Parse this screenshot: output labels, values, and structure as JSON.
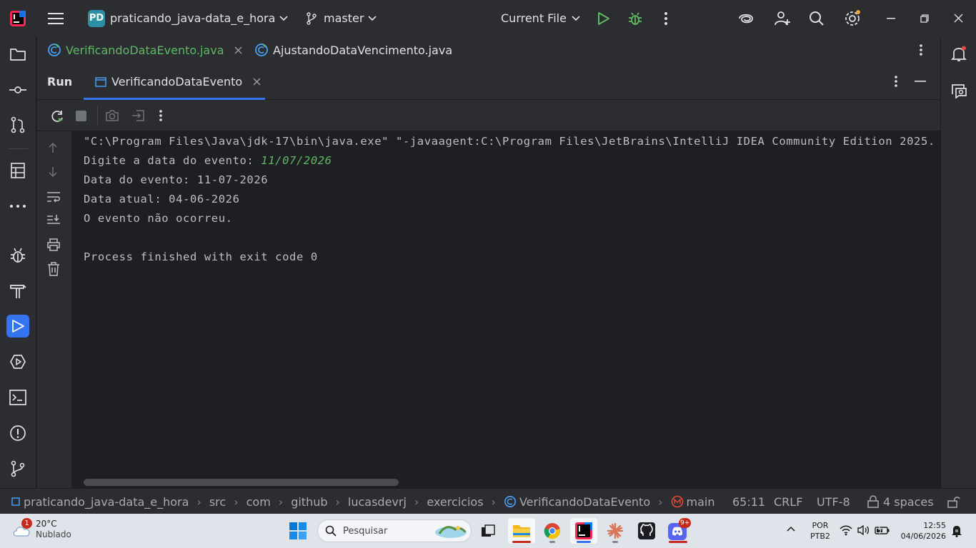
{
  "titlebar": {
    "project_badge": "PD",
    "project_name": "praticando_java-data_e_hora",
    "branch": "master",
    "run_config": "Current File"
  },
  "editor_tabs": [
    {
      "label": "VerificandoDataEvento.java",
      "color": "#5fb865"
    },
    {
      "label": "AjustandoDataVencimento.java",
      "color": "#dfe1e5"
    }
  ],
  "run_window": {
    "title": "Run",
    "tab_label": "VerificandoDataEvento"
  },
  "console": {
    "lines": [
      "\"C:\\Program Files\\Java\\jdk-17\\bin\\java.exe\" \"-javaagent:C:\\Program Files\\JetBrains\\IntelliJ IDEA Community Edition 2025.",
      "Digite a data do evento: ",
      "Data do evento: 11-07-2026",
      "Data atual: 04-06-2026",
      "O evento não ocorreu.",
      "Process finished with exit code 0"
    ],
    "user_input": "11/07/2026"
  },
  "statusbar": {
    "breadcrumbs": [
      "praticando_java-data_e_hora",
      "src",
      "com",
      "github",
      "lucasdevrj",
      "exercicios",
      "VerificandoDataEvento",
      "main"
    ],
    "position": "65:11",
    "line_sep": "CRLF",
    "encoding": "UTF-8",
    "indent": "4 spaces"
  },
  "taskbar": {
    "weather_temp": "20°C",
    "weather_desc": "Nublado",
    "weather_badge": "1",
    "search_placeholder": "Pesquisar",
    "lang_top": "POR",
    "lang_bottom": "PTB2",
    "time": "12:55",
    "date": "04/06/2026",
    "discord_badge": "9+"
  },
  "colors": {
    "accent": "#3574f0",
    "run_green": "#5fb865",
    "background": "#1e1f22",
    "panel": "#2b2d30"
  }
}
